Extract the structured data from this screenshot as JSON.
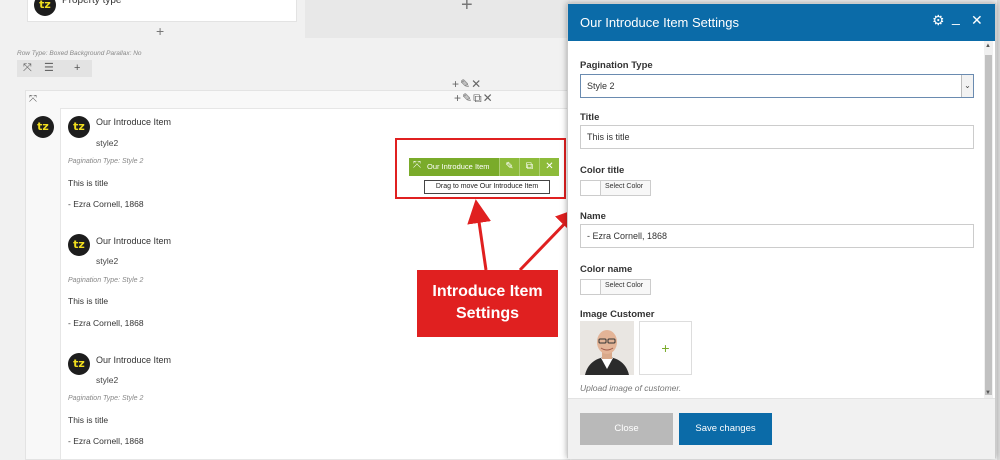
{
  "top": {
    "property_type": "Property type",
    "plus": "+",
    "row_type": "Row Type: Boxed  Background Parallax: No"
  },
  "icons": {
    "tz_logo": "tz",
    "plus": "+",
    "tools": "+✎✕",
    "tools2": "+✎⧉✕",
    "expand": "⤧",
    "list": "☰"
  },
  "items": [
    {
      "title": "Our Introduce Item",
      "style": "style2",
      "pagination": "Pagination Type: Style 2",
      "text": "This is title",
      "author": "- Ezra Cornell, 1868"
    },
    {
      "title": "Our Introduce Item",
      "style": "style2",
      "pagination": "Pagination Type: Style 2",
      "text": "This is title",
      "author": "- Ezra Cornell, 1868"
    },
    {
      "title": "Our Introduce Item",
      "style": "style2",
      "pagination": "Pagination Type: Style 2",
      "text": "This is title",
      "author": "- Ezra Cornell, 1868"
    }
  ],
  "toolbar": {
    "label": "Our Introduce Item",
    "tooltip": "Drag to move Our Introduce Item"
  },
  "callout": {
    "line1": "Introduce Item",
    "line2": "Settings",
    "color": "#e02020"
  },
  "modal": {
    "title": "Our Introduce Item Settings",
    "header_color": "#0b6ba8",
    "pagination_label": "Pagination Type",
    "pagination_value": "Style 2",
    "title_label": "Title",
    "title_value": "This is title",
    "color_title_label": "Color title",
    "select_color": "Select Color",
    "name_label": "Name",
    "name_value": "- Ezra Cornell, 1868",
    "color_name_label": "Color name",
    "image_label": "Image Customer",
    "image_hint": "Upload image of customer.",
    "close_label": "Close",
    "save_label": "Save changes"
  }
}
